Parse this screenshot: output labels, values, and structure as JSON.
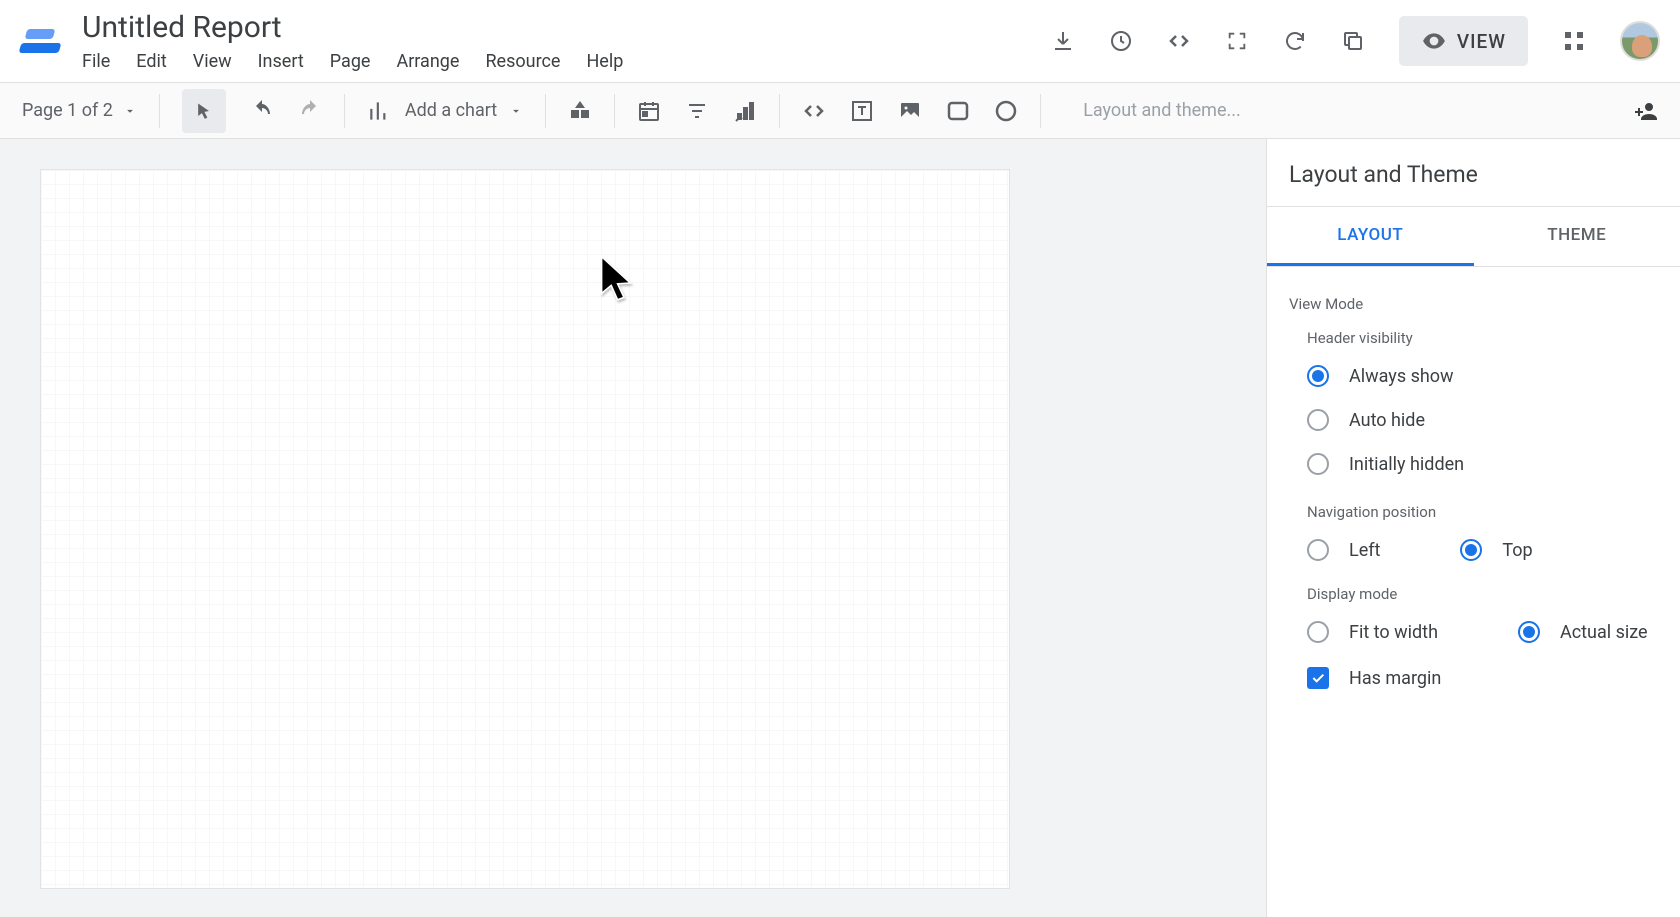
{
  "header": {
    "title": "Untitled Report",
    "menu": [
      "File",
      "Edit",
      "View",
      "Insert",
      "Page",
      "Arrange",
      "Resource",
      "Help"
    ],
    "view_button": "VIEW"
  },
  "toolbar": {
    "page_label": "Page 1 of 2",
    "add_chart_label": "Add a chart",
    "layout_theme_label": "Layout and theme..."
  },
  "panel": {
    "title": "Layout and Theme",
    "tab_layout": "LAYOUT",
    "tab_theme": "THEME",
    "view_mode_title": "View Mode",
    "header_visibility_title": "Header visibility",
    "header_visibility_options": [
      "Always show",
      "Auto hide",
      "Initially hidden"
    ],
    "header_visibility_selected": 0,
    "nav_position_title": "Navigation position",
    "nav_position_options": [
      "Left",
      "Top"
    ],
    "nav_position_selected": 1,
    "display_mode_title": "Display mode",
    "display_mode_options": [
      "Fit to width",
      "Actual size"
    ],
    "display_mode_selected": 1,
    "has_margin_label": "Has margin",
    "has_margin_checked": true
  }
}
